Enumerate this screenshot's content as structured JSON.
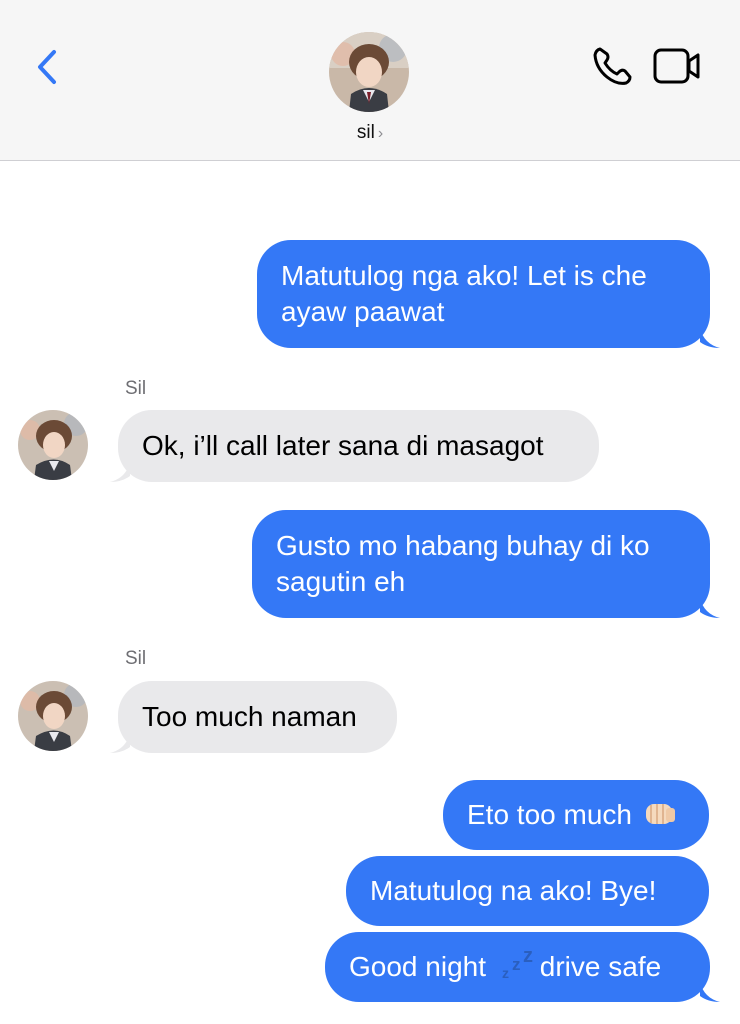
{
  "header": {
    "contact_name": "sil",
    "chevron": "›",
    "back_icon": "chevron-left-icon",
    "call_icon": "phone-icon",
    "video_icon": "video-camera-icon",
    "accent_color": "#3478f6"
  },
  "messages": [
    {
      "direction": "outgoing",
      "text": "Matutulog nga ako! Let is che ayaw paawat"
    },
    {
      "direction": "incoming",
      "sender": "Sil",
      "text": "Ok, i’ll call later sana di masagot"
    },
    {
      "direction": "outgoing",
      "text": "Gusto mo habang buhay di ko sagutin eh"
    },
    {
      "direction": "incoming",
      "sender": "Sil",
      "text": "Too much naman"
    },
    {
      "direction": "outgoing",
      "text": "Eto too much",
      "emoji": "fist-bump-icon"
    },
    {
      "direction": "outgoing",
      "text": "Matutulog na ako! Bye!"
    },
    {
      "direction": "outgoing",
      "text_before": "Good night",
      "emoji": "zzz-icon",
      "text_after": "drive safe"
    }
  ],
  "colors": {
    "outgoing_bubble": "#3478f6",
    "incoming_bubble": "#e9e9eb",
    "header_bg": "#f6f6f6"
  }
}
